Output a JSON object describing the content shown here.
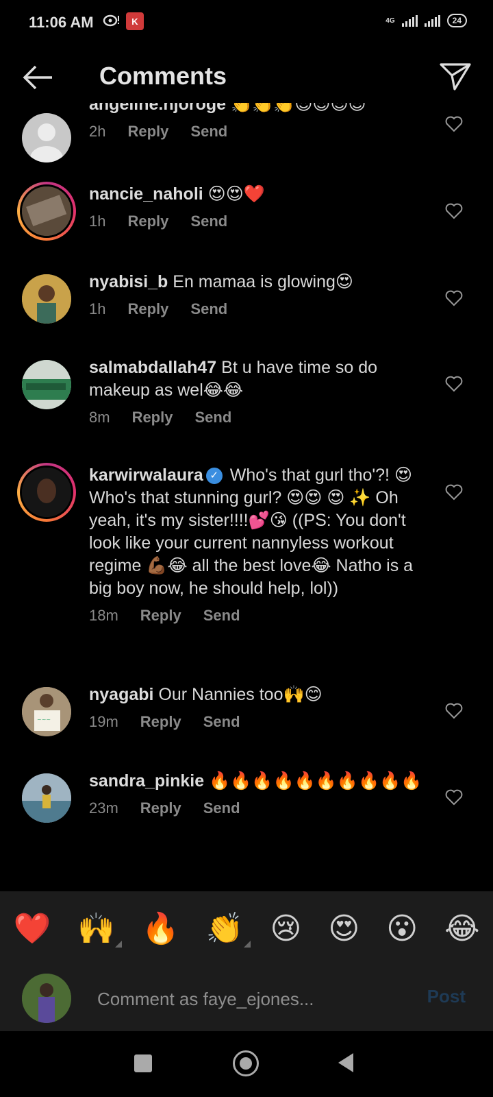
{
  "status_bar": {
    "time": "11:06 AM",
    "notif_k": "K",
    "network": "4G",
    "battery": "24"
  },
  "header": {
    "title": "Comments",
    "back_icon": "arrow-left-icon",
    "share_icon": "send-icon"
  },
  "comments": [
    {
      "username": "angeline.njoroge",
      "text": "👏👏👏😍😍😍😍",
      "time": "2h",
      "reply": "Reply",
      "send": "Send",
      "avatar_color": "#c8c8c8"
    },
    {
      "username": "nancie_naholi",
      "text": "😍😍❤️",
      "time": "1h",
      "reply": "Reply",
      "send": "Send",
      "avatar_color": "#6b5a4a"
    },
    {
      "username": "nyabisi_b",
      "text": "En mamaa is glowing😍",
      "time": "1h",
      "reply": "Reply",
      "send": "Send",
      "avatar_color": "#b08a40"
    },
    {
      "username": "salmabdallah47",
      "text": "Bt u have time so do makeup as wel😂😂",
      "time": "8m",
      "reply": "Reply",
      "send": "Send",
      "avatar_color": "#2e7d4f"
    },
    {
      "username": "karwirwalaura",
      "text": "Who's that gurl tho'?! 😍 Who's that stunning gurl? 😍😍 😍 ✨ Oh yeah, it's my sister!!!!💕😘 ((PS: You don't look like your current nannyless workout regime 💪🏾😂 all the best love😂 Natho is a big boy now, he should help, lol))",
      "time": "18m",
      "reply": "Reply",
      "send": "Send",
      "avatar_color": "#2a2a2a"
    },
    {
      "username": "nyagabi",
      "text": "Our Nannies too🙌😊",
      "time": "19m",
      "reply": "Reply",
      "send": "Send",
      "avatar_color": "#9c8a70"
    },
    {
      "username": "sandra_pinkie",
      "text": "🔥🔥🔥🔥🔥🔥🔥🔥🔥🔥",
      "time": "23m",
      "reply": "Reply",
      "send": "Send",
      "avatar_color": "#6f8aa0"
    }
  ],
  "reactions": [
    "❤️",
    "🙌",
    "🔥",
    "👏",
    "😢",
    "😍",
    "😮",
    "😂"
  ],
  "input": {
    "placeholder": "Comment as faye_ejones...",
    "post_label": "Post",
    "avatar_color": "#3e5a2e"
  },
  "nav": {
    "square_icon": "recent-apps-icon",
    "home_icon": "home-icon",
    "back_icon": "back-triangle-icon"
  },
  "colors": {
    "background": "#000000",
    "panel": "#1c1c1c",
    "muted_text": "#8a8a8a",
    "post_disabled": "#1e3a55",
    "verified": "#3a8ee0"
  }
}
